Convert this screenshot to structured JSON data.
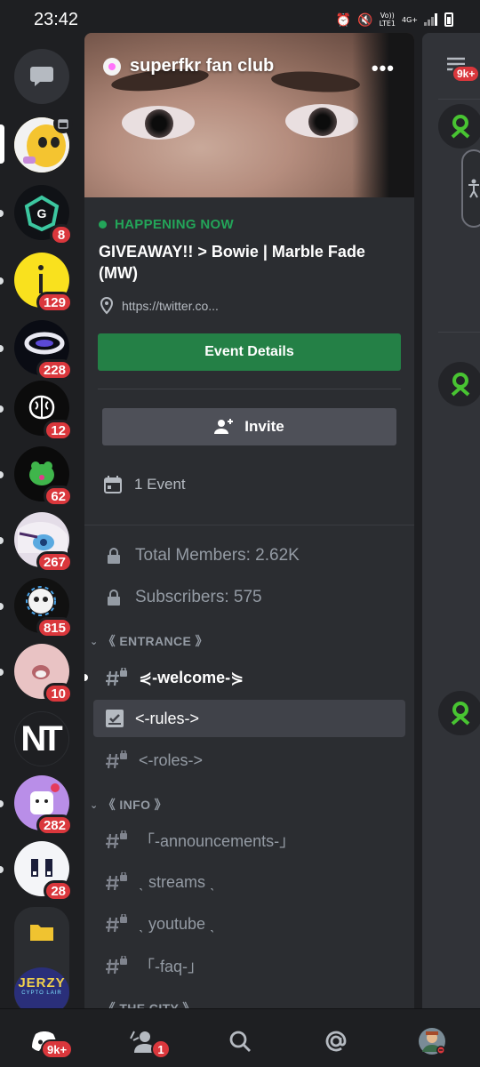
{
  "status_bar": {
    "time": "23:42",
    "network_top": "Vo))",
    "network_bottom": "LTE1",
    "network_gen": "4G+"
  },
  "server_rail": {
    "servers": [
      {
        "badge": ""
      },
      {
        "badge": "8"
      },
      {
        "badge": "129"
      },
      {
        "badge": "228"
      },
      {
        "badge": "12"
      },
      {
        "badge": "62"
      },
      {
        "badge": "267"
      },
      {
        "badge": "815"
      },
      {
        "badge": "10"
      },
      {
        "badge": "",
        "logo_text": "NT"
      },
      {
        "badge": "282"
      },
      {
        "badge": "28"
      }
    ],
    "folder_label": "JERZY",
    "folder_sub": "CYPTO LAIR"
  },
  "server": {
    "name": "superfkr fan club"
  },
  "event": {
    "status": "HAPPENING NOW",
    "title": "GIVEAWAY!! > Bowie | Marble Fade (MW)",
    "location": "https://twitter.co...",
    "details_button": "Event Details"
  },
  "invite_button": "Invite",
  "events_count": "1 Event",
  "stats": {
    "total_members": "Total Members: 2.62K",
    "subscribers": "Subscribers: 575"
  },
  "categories": {
    "entrance": "《 ENTRANCE 》",
    "info": "《 INFO 》",
    "city": "《 THE CITY 》"
  },
  "channels": {
    "welcome": "⋞-welcome-⋟",
    "rules": "<-rules->",
    "roles": "<-roles->",
    "announcements": "「-announcements-」",
    "streams": "ˎ streams ˎ",
    "youtube": "ˎ youtube ˎ",
    "faq": "「-faq-」"
  },
  "right_peek": {
    "badge": "9k+"
  },
  "bottom_nav": {
    "home_badge": "9k+",
    "friends_badge": "1"
  },
  "colors": {
    "accent_green": "#23a559",
    "button_green": "#248046",
    "badge_red": "#da373c",
    "panel": "#2b2d31",
    "background": "#1e1f22"
  }
}
